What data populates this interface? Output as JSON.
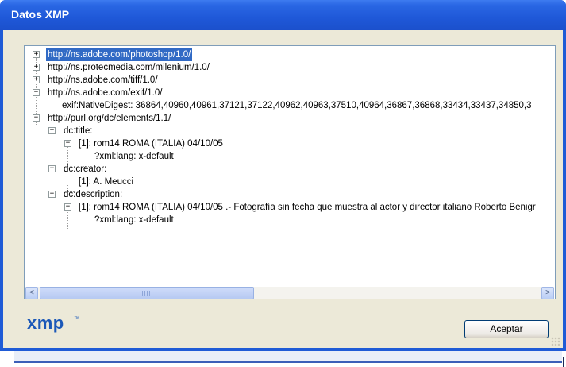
{
  "window": {
    "title": "Datos XMP"
  },
  "tree": {
    "nodes": [
      {
        "label": "http://ns.adobe.com/photoshop/1.0/",
        "expander": "+"
      },
      {
        "label": "http://ns.protecmedia.com/milenium/1.0/",
        "expander": "+"
      },
      {
        "label": "http://ns.adobe.com/tiff/1.0/",
        "expander": "+"
      },
      {
        "label": "http://ns.adobe.com/exif/1.0/",
        "expander": "−"
      },
      {
        "label": "exif:NativeDigest: 36864,40960,40961,37121,37122,40962,40963,37510,40964,36867,36868,33434,33437,34850,3"
      },
      {
        "label": "http://purl.org/dc/elements/1.1/",
        "expander": "−"
      },
      {
        "label": "dc:title:",
        "expander": "−"
      },
      {
        "label": "[1]: rom14 ROMA (ITALIA) 04/10/05",
        "expander": "−"
      },
      {
        "label": "?xml:lang: x-default"
      },
      {
        "label": "dc:creator:",
        "expander": "−"
      },
      {
        "label": "[1]: A. Meucci"
      },
      {
        "label": "dc:description:",
        "expander": "−"
      },
      {
        "label": "[1]: rom14 ROMA (ITALIA) 04/10/05 .- Fotografía sin fecha que muestra al actor y director italiano Roberto Benigr",
        "expander": "−"
      },
      {
        "label": "?xml:lang: x-default"
      }
    ]
  },
  "scrollbar": {
    "left_arrow": "<",
    "right_arrow": ">"
  },
  "footer": {
    "logo": "xmp",
    "logo_mark": "™",
    "ok_label": "Aceptar"
  }
}
